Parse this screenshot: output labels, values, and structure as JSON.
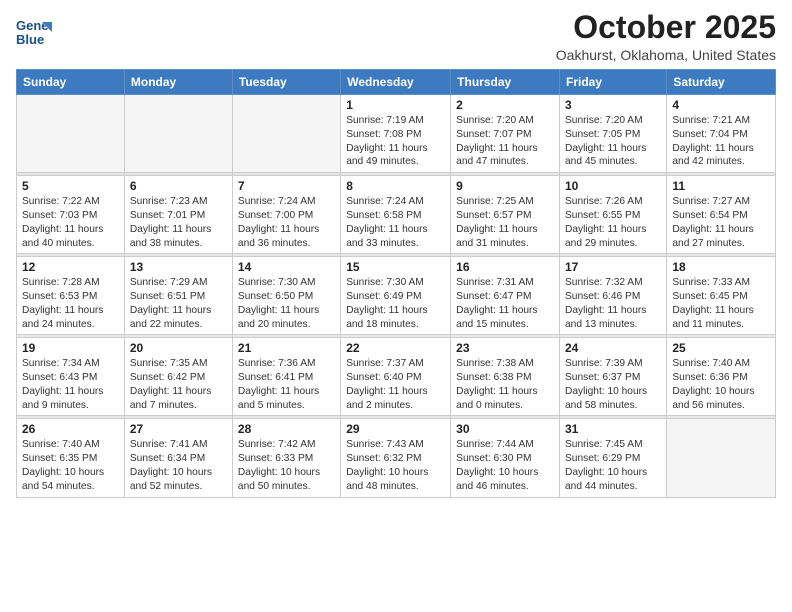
{
  "logo": {
    "name1": "General",
    "name2": "Blue"
  },
  "header": {
    "month": "October 2025",
    "location": "Oakhurst, Oklahoma, United States"
  },
  "weekdays": [
    "Sunday",
    "Monday",
    "Tuesday",
    "Wednesday",
    "Thursday",
    "Friday",
    "Saturday"
  ],
  "weeks": [
    [
      {
        "day": "",
        "detail": ""
      },
      {
        "day": "",
        "detail": ""
      },
      {
        "day": "",
        "detail": ""
      },
      {
        "day": "1",
        "detail": "Sunrise: 7:19 AM\nSunset: 7:08 PM\nDaylight: 11 hours\nand 49 minutes."
      },
      {
        "day": "2",
        "detail": "Sunrise: 7:20 AM\nSunset: 7:07 PM\nDaylight: 11 hours\nand 47 minutes."
      },
      {
        "day": "3",
        "detail": "Sunrise: 7:20 AM\nSunset: 7:05 PM\nDaylight: 11 hours\nand 45 minutes."
      },
      {
        "day": "4",
        "detail": "Sunrise: 7:21 AM\nSunset: 7:04 PM\nDaylight: 11 hours\nand 42 minutes."
      }
    ],
    [
      {
        "day": "5",
        "detail": "Sunrise: 7:22 AM\nSunset: 7:03 PM\nDaylight: 11 hours\nand 40 minutes."
      },
      {
        "day": "6",
        "detail": "Sunrise: 7:23 AM\nSunset: 7:01 PM\nDaylight: 11 hours\nand 38 minutes."
      },
      {
        "day": "7",
        "detail": "Sunrise: 7:24 AM\nSunset: 7:00 PM\nDaylight: 11 hours\nand 36 minutes."
      },
      {
        "day": "8",
        "detail": "Sunrise: 7:24 AM\nSunset: 6:58 PM\nDaylight: 11 hours\nand 33 minutes."
      },
      {
        "day": "9",
        "detail": "Sunrise: 7:25 AM\nSunset: 6:57 PM\nDaylight: 11 hours\nand 31 minutes."
      },
      {
        "day": "10",
        "detail": "Sunrise: 7:26 AM\nSunset: 6:55 PM\nDaylight: 11 hours\nand 29 minutes."
      },
      {
        "day": "11",
        "detail": "Sunrise: 7:27 AM\nSunset: 6:54 PM\nDaylight: 11 hours\nand 27 minutes."
      }
    ],
    [
      {
        "day": "12",
        "detail": "Sunrise: 7:28 AM\nSunset: 6:53 PM\nDaylight: 11 hours\nand 24 minutes."
      },
      {
        "day": "13",
        "detail": "Sunrise: 7:29 AM\nSunset: 6:51 PM\nDaylight: 11 hours\nand 22 minutes."
      },
      {
        "day": "14",
        "detail": "Sunrise: 7:30 AM\nSunset: 6:50 PM\nDaylight: 11 hours\nand 20 minutes."
      },
      {
        "day": "15",
        "detail": "Sunrise: 7:30 AM\nSunset: 6:49 PM\nDaylight: 11 hours\nand 18 minutes."
      },
      {
        "day": "16",
        "detail": "Sunrise: 7:31 AM\nSunset: 6:47 PM\nDaylight: 11 hours\nand 15 minutes."
      },
      {
        "day": "17",
        "detail": "Sunrise: 7:32 AM\nSunset: 6:46 PM\nDaylight: 11 hours\nand 13 minutes."
      },
      {
        "day": "18",
        "detail": "Sunrise: 7:33 AM\nSunset: 6:45 PM\nDaylight: 11 hours\nand 11 minutes."
      }
    ],
    [
      {
        "day": "19",
        "detail": "Sunrise: 7:34 AM\nSunset: 6:43 PM\nDaylight: 11 hours\nand 9 minutes."
      },
      {
        "day": "20",
        "detail": "Sunrise: 7:35 AM\nSunset: 6:42 PM\nDaylight: 11 hours\nand 7 minutes."
      },
      {
        "day": "21",
        "detail": "Sunrise: 7:36 AM\nSunset: 6:41 PM\nDaylight: 11 hours\nand 5 minutes."
      },
      {
        "day": "22",
        "detail": "Sunrise: 7:37 AM\nSunset: 6:40 PM\nDaylight: 11 hours\nand 2 minutes."
      },
      {
        "day": "23",
        "detail": "Sunrise: 7:38 AM\nSunset: 6:38 PM\nDaylight: 11 hours\nand 0 minutes."
      },
      {
        "day": "24",
        "detail": "Sunrise: 7:39 AM\nSunset: 6:37 PM\nDaylight: 10 hours\nand 58 minutes."
      },
      {
        "day": "25",
        "detail": "Sunrise: 7:40 AM\nSunset: 6:36 PM\nDaylight: 10 hours\nand 56 minutes."
      }
    ],
    [
      {
        "day": "26",
        "detail": "Sunrise: 7:40 AM\nSunset: 6:35 PM\nDaylight: 10 hours\nand 54 minutes."
      },
      {
        "day": "27",
        "detail": "Sunrise: 7:41 AM\nSunset: 6:34 PM\nDaylight: 10 hours\nand 52 minutes."
      },
      {
        "day": "28",
        "detail": "Sunrise: 7:42 AM\nSunset: 6:33 PM\nDaylight: 10 hours\nand 50 minutes."
      },
      {
        "day": "29",
        "detail": "Sunrise: 7:43 AM\nSunset: 6:32 PM\nDaylight: 10 hours\nand 48 minutes."
      },
      {
        "day": "30",
        "detail": "Sunrise: 7:44 AM\nSunset: 6:30 PM\nDaylight: 10 hours\nand 46 minutes."
      },
      {
        "day": "31",
        "detail": "Sunrise: 7:45 AM\nSunset: 6:29 PM\nDaylight: 10 hours\nand 44 minutes."
      },
      {
        "day": "",
        "detail": ""
      }
    ]
  ]
}
